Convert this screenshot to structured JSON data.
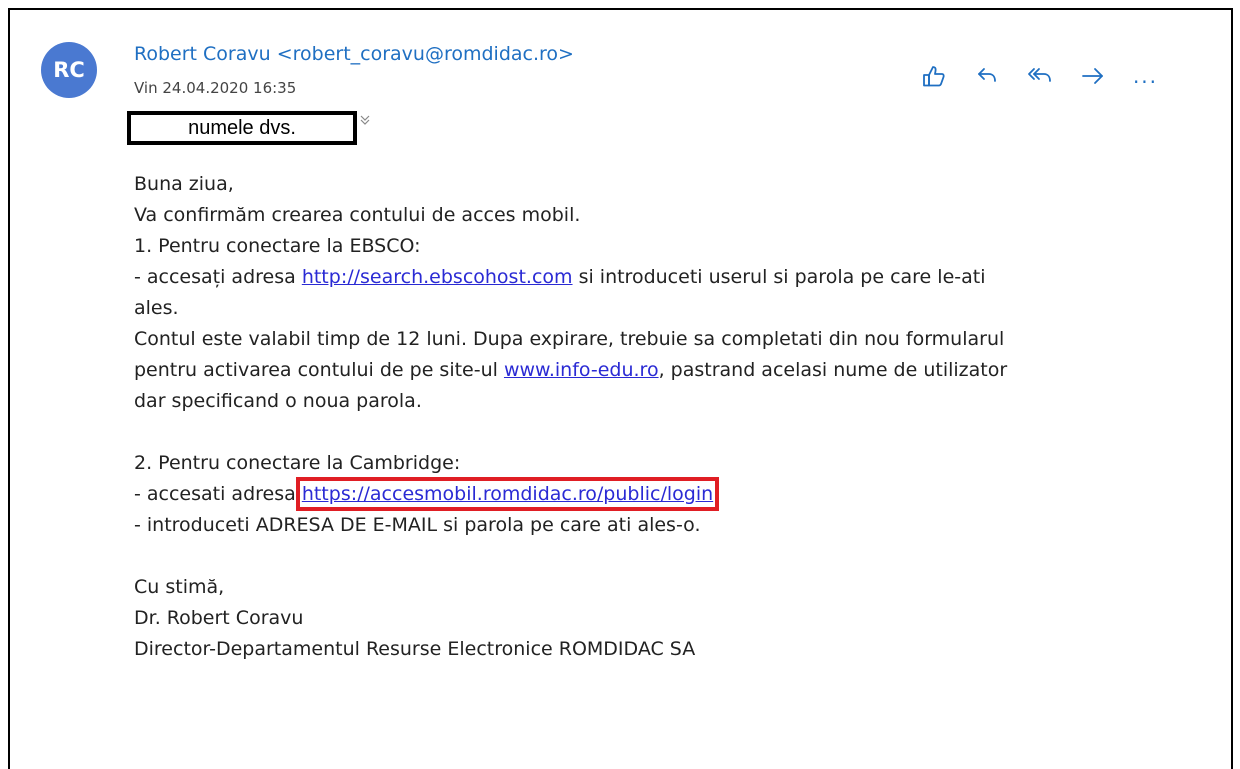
{
  "email": {
    "avatar_initials": "RC",
    "sender": "Robert Coravu <robert_coravu@romdidac.ro>",
    "date": "Vin 24.04.2020 16:35",
    "recipient_placeholder": "numele dvs."
  },
  "actions": {
    "like_icon": "thumbs-up-icon",
    "reply_icon": "reply-icon",
    "reply_all_icon": "reply-all-icon",
    "forward_icon": "forward-icon",
    "more_label": "..."
  },
  "body": {
    "greeting": "Buna ziua,",
    "line1": "Va confirmăm crearea contului de acces mobil.",
    "ebsco_heading": "1. Pentru conectare la EBSCO:",
    "ebsco_pre": "- accesați adresa ",
    "ebsco_link": "http://search.ebscohost.com",
    "ebsco_post": " si introduceti userul si parola pe care le-ati",
    "ebsco_post2": "ales.",
    "valid_line1": "Contul este valabil timp de 12 luni. Dupa expirare, trebuie sa completati din nou formularul",
    "valid_pre": "pentru activarea contului de pe site-ul ",
    "valid_link": "www.info-edu.ro",
    "valid_post": ", pastrand acelasi nume de utilizator",
    "valid_line3": "dar specificand o noua parola.",
    "cambridge_heading": "2. Pentru conectare la Cambridge:",
    "cambridge_pre": "- accesati adresa ",
    "cambridge_link": "https://accesmobil.romdidac.ro/public/login",
    "cambridge_line2": "- introduceti ADRESA DE E-MAIL si parola pe care ati ales-o.",
    "signoff": "Cu stimă,",
    "sig_name": "Dr. Robert Coravu",
    "sig_title": "Director-Departamentul Resurse Electronice ROMDIDAC SA"
  },
  "colors": {
    "accent": "#1f6fc2",
    "avatar": "#4a79d1",
    "highlight": "#e01e24"
  }
}
